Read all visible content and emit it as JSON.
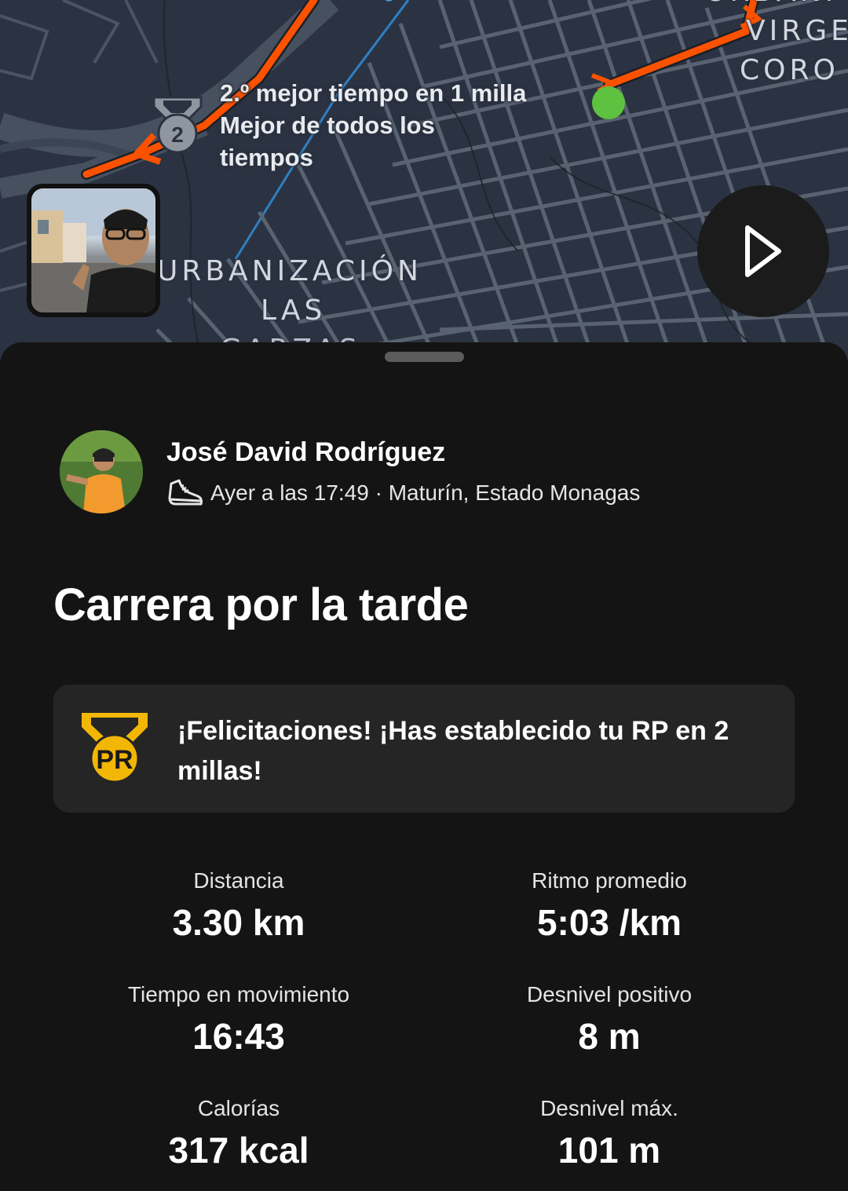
{
  "map": {
    "segment_effort": {
      "line1": "2.º mejor tiempo en 1 milla",
      "line2": "Mejor de todos los",
      "line3": "tiempos",
      "medal_number": "2",
      "medal_icon": "silver-medal-icon"
    },
    "place_labels": {
      "urbanizacion_line1": "URBANIZACIÓN",
      "urbanizacion_line2": "LAS",
      "urbanizacion_line3": "GARZAS",
      "virgen": "VIRGE",
      "coro": "CORO",
      "urban_top": "URBANI"
    },
    "street_label": "Ca",
    "route_color": "#fc5200",
    "end_marker_color": "#5ec13f",
    "play_icon": "play-icon"
  },
  "athlete": {
    "name": "José David Rodríguez",
    "activity_icon": "running-shoe-icon",
    "meta": "Ayer a las 17:49 · Maturín, Estado Monagas"
  },
  "activity": {
    "title": "Carrera por la tarde"
  },
  "achievement": {
    "icon": "pr-medal-icon",
    "badge_text": "PR",
    "message": "¡Felicitaciones! ¡Has establecido tu RP en 2 millas!",
    "accent_color": "#f2b705"
  },
  "stats": [
    {
      "label": "Distancia",
      "value": "3.30 km"
    },
    {
      "label": "Ritmo promedio",
      "value": "5:03 /km"
    },
    {
      "label": "Tiempo en movimiento",
      "value": "16:43"
    },
    {
      "label": "Desnivel positivo",
      "value": "8 m"
    },
    {
      "label": "Calorías",
      "value": "317 kcal"
    },
    {
      "label": "Desnivel máx.",
      "value": "101 m"
    }
  ]
}
